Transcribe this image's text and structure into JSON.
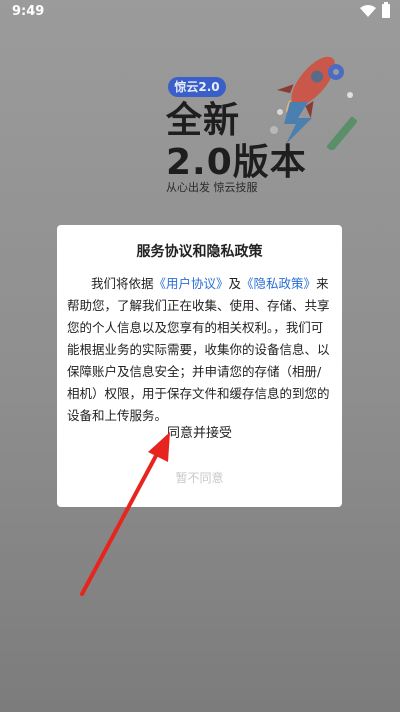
{
  "status_bar": {
    "time": "9:49",
    "icons": [
      "wifi-icon",
      "battery-icon"
    ]
  },
  "splash": {
    "version_badge": "惊云2.0",
    "headline_line1": "全新",
    "headline_line2": "2.0版本",
    "slogan": "从心出发 惊云技服",
    "illustration": "rocket-icon"
  },
  "dialog": {
    "title": "服务协议和隐私政策",
    "body_prefix": "我们将依据",
    "user_agreement_link": "《用户协议》",
    "and_text": "及",
    "privacy_policy_link": "《隐私政策》",
    "body_suffix": "来帮助您，了解我们正在收集、使用、存储、共享您的个人信息以及您享有的相关权利。，我们可能根据业务的实际需要，收集你的设备信息、以保障账户及信息安全；并申请您的存储（相册/相机）权限，用于保存文件和缓存信息的到您的设备和上传服务。",
    "agree_label": "同意并接受",
    "decline_label": "暂不同意"
  },
  "annotation": {
    "arrow_color": "#e8241f",
    "points_to": "agree-button"
  },
  "colors": {
    "badge": "#3b5fc8",
    "link": "#2a6fd6",
    "decline_text": "#c8c8c8",
    "scrim": "#8e8e8e"
  }
}
